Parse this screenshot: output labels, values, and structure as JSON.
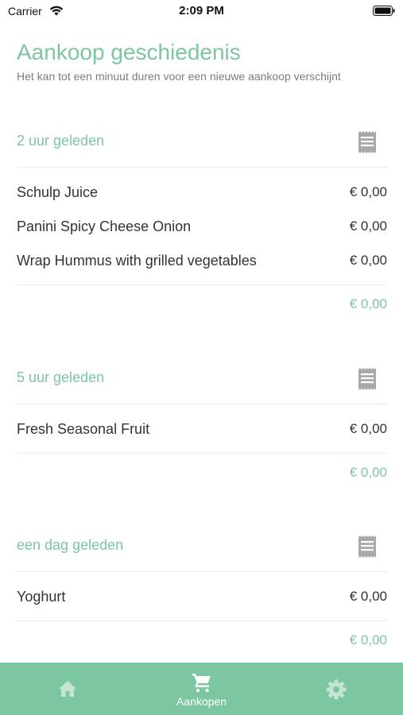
{
  "status_bar": {
    "carrier": "Carrier",
    "time": "2:09 PM"
  },
  "header": {
    "title": "Aankoop geschiedenis",
    "subtitle": "Het kan tot een minuut duren voor een nieuwe aankoop verschijnt"
  },
  "groups": [
    {
      "time": "2 uur geleden",
      "icon": "receipt-icon",
      "items": [
        {
          "name": "Schulp Juice",
          "price": "€ 0,00"
        },
        {
          "name": "Panini Spicy Cheese Onion",
          "price": "€ 0,00"
        },
        {
          "name": "Wrap Hummus with grilled vegetables",
          "price": "€ 0,00"
        }
      ],
      "total": "€ 0,00"
    },
    {
      "time": "5 uur geleden",
      "icon": "receipt-icon",
      "items": [
        {
          "name": "Fresh Seasonal Fruit",
          "price": "€ 0,00"
        }
      ],
      "total": "€ 0,00"
    },
    {
      "time": "een dag geleden",
      "icon": "receipt-icon",
      "items": [
        {
          "name": "Yoghurt",
          "price": "€ 0,00"
        }
      ],
      "total": "€ 0,00"
    }
  ],
  "tab_bar": {
    "tabs": [
      {
        "icon": "home-icon",
        "label": ""
      },
      {
        "icon": "cart-icon",
        "label": "Aankopen",
        "active": true
      },
      {
        "icon": "gear-icon",
        "label": ""
      }
    ]
  },
  "colors": {
    "accent": "#7cc6a2",
    "text": "#333333",
    "subtitle": "#7d7d7d",
    "divider": "#ececec"
  }
}
